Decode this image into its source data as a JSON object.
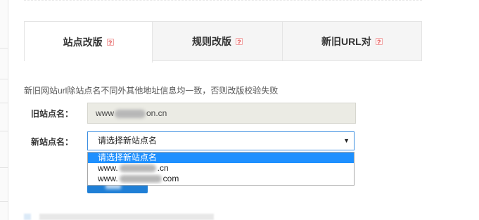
{
  "tabs": [
    {
      "label": "站点改版",
      "active": true,
      "help_icon": "help-icon"
    },
    {
      "label": "规则改版",
      "active": false,
      "help_icon": "help-icon"
    },
    {
      "label": "新旧URL对",
      "active": false,
      "help_icon": "help-icon"
    }
  ],
  "help_glyph": "?",
  "notice": "新旧网站url除站点名不同外其他地址信息均一致，否则改版校验失败",
  "old_site": {
    "label": "旧站点名：",
    "value_prefix": "www",
    "value_suffix": "on.cn"
  },
  "new_site": {
    "label": "新站点名：",
    "selected": "请选择新站点名",
    "arrow_icon": "caret-down-icon",
    "arrow_glyph": "▼"
  },
  "dropdown": {
    "options": [
      {
        "prefix": "请选择新站点名",
        "suffix": ""
      },
      {
        "prefix": "www.",
        "suffix": ".cn"
      },
      {
        "prefix": "www.",
        "suffix": "com"
      }
    ]
  },
  "colors": {
    "accent": "#1e90ff",
    "select_border": "#3c8ee0",
    "help_red": "#e04f4f",
    "disabled_bg": "#ebebe4"
  }
}
